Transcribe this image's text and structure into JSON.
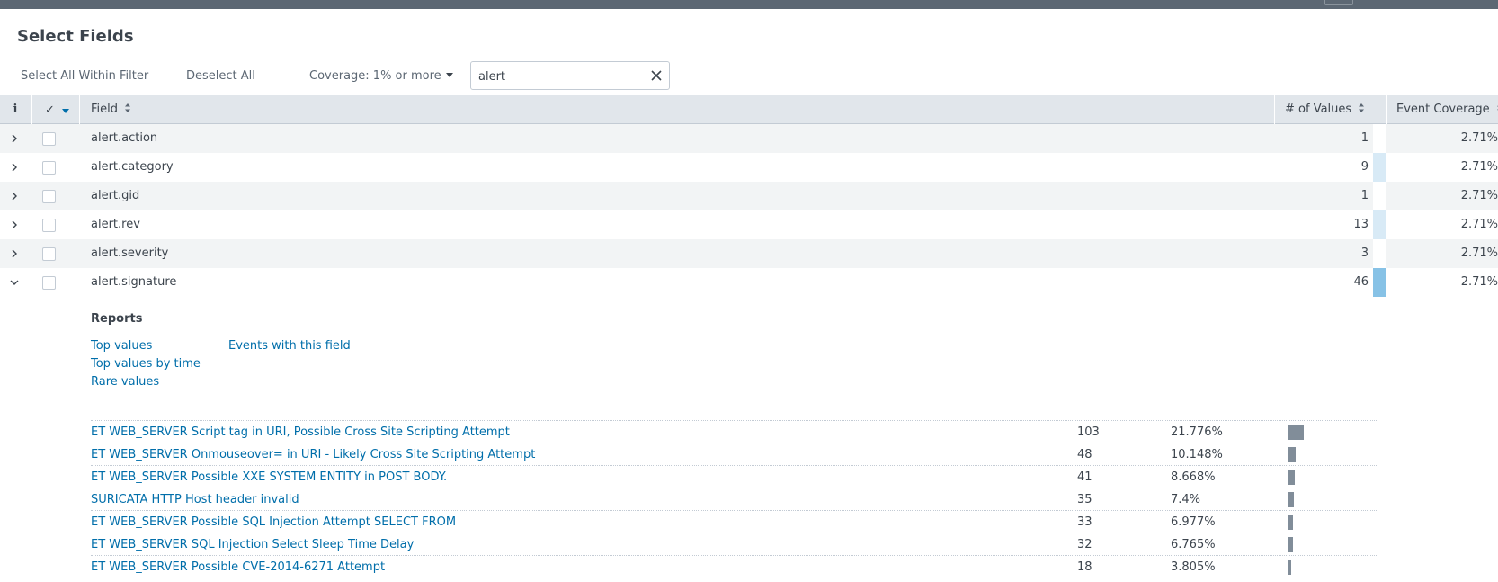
{
  "dialog": {
    "title": "Select Fields"
  },
  "toolbar": {
    "select_all": "Select All Within Filter",
    "deselect_all": "Deselect All",
    "coverage": "Coverage: 1% or more",
    "filter_value": "alert"
  },
  "table": {
    "headers": {
      "info": "i",
      "check": "✓",
      "field": "Field",
      "num_values": "# of Values",
      "event_coverage": "Event Coverage"
    },
    "rows": [
      {
        "field": "alert.action",
        "num_values": "1",
        "values_fill": 0.0,
        "coverage": "2.71%",
        "expanded": false
      },
      {
        "field": "alert.category",
        "num_values": "9",
        "values_fill": 1.0,
        "coverage": "2.71%",
        "expanded": false
      },
      {
        "field": "alert.gid",
        "num_values": "1",
        "values_fill": 0.0,
        "coverage": "2.71%",
        "expanded": false
      },
      {
        "field": "alert.rev",
        "num_values": "13",
        "values_fill": 1.0,
        "coverage": "2.71%",
        "expanded": false
      },
      {
        "field": "alert.severity",
        "num_values": "3",
        "values_fill": 0.0,
        "coverage": "2.71%",
        "expanded": false
      },
      {
        "field": "alert.signature",
        "num_values": "46",
        "values_fill": 1.0,
        "coverage": "2.71%",
        "expanded": true
      }
    ]
  },
  "reports": {
    "title": "Reports",
    "top_values": "Top values",
    "top_values_by_time": "Top values by time",
    "rare_values": "Rare values",
    "events_with_field": "Events with this field"
  },
  "values": [
    {
      "label": "ET WEB_SERVER Script tag in URI, Possible Cross Site Scripting Attempt",
      "count": "103",
      "percent": "21.776%",
      "share": 21.776
    },
    {
      "label": "ET WEB_SERVER Onmouseover= in URI - Likely Cross Site Scripting Attempt",
      "count": "48",
      "percent": "10.148%",
      "share": 10.148
    },
    {
      "label": "ET WEB_SERVER Possible XXE SYSTEM ENTITY in POST BODY.",
      "count": "41",
      "percent": "8.668%",
      "share": 8.668
    },
    {
      "label": "SURICATA HTTP Host header invalid",
      "count": "35",
      "percent": "7.4%",
      "share": 7.4
    },
    {
      "label": "ET WEB_SERVER Possible SQL Injection Attempt SELECT FROM",
      "count": "33",
      "percent": "6.977%",
      "share": 6.977
    },
    {
      "label": "ET WEB_SERVER SQL Injection Select Sleep Time Delay",
      "count": "32",
      "percent": "6.765%",
      "share": 6.765
    },
    {
      "label": "ET WEB_SERVER Possible CVE-2014-6271 Attempt",
      "count": "18",
      "percent": "3.805%",
      "share": 3.805
    }
  ],
  "colors": {
    "link": "#006eaa",
    "header_bg": "#e1e6eb",
    "value_bar": "#818d99",
    "selected_bar": "#87c2e6"
  }
}
